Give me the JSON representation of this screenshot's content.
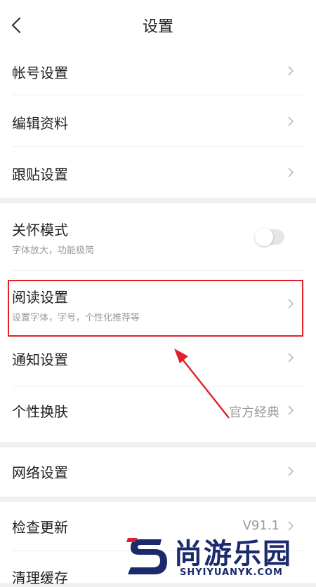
{
  "header": {
    "title": "设置"
  },
  "groups": [
    {
      "items": [
        {
          "label": "帐号设置"
        },
        {
          "label": "编辑资料"
        },
        {
          "label": "跟贴设置"
        }
      ]
    },
    {
      "items": [
        {
          "label": "关怀模式",
          "subtitle": "字体放大，功能极简",
          "toggle": false
        },
        {
          "label": "阅读设置",
          "subtitle": "设置字体，字号，个性化推荐等"
        },
        {
          "label": "通知设置"
        },
        {
          "label": "个性换肤",
          "value": "官方经典"
        }
      ]
    },
    {
      "items": [
        {
          "label": "网络设置"
        }
      ]
    },
    {
      "items": [
        {
          "label": "检查更新",
          "value": "V91.1"
        },
        {
          "label": "清理缓存"
        }
      ]
    }
  ],
  "annotation": {
    "color": "#e0202a"
  },
  "watermark": {
    "cn": "尚游乐园",
    "en": "SHYIYUANYK.COM"
  },
  "colors": {
    "accent_red": "#e0202a",
    "watermark_blue": "#1a2a6c"
  }
}
